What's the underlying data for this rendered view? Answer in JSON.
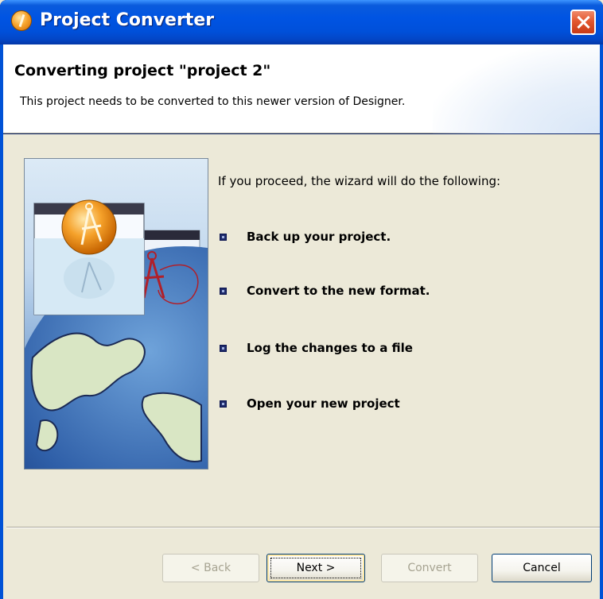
{
  "window": {
    "title": "Project Converter",
    "title_icon": "project-converter-app-icon",
    "close_icon": "close-icon"
  },
  "header": {
    "title": "Converting project \"project 2\"",
    "subtitle": "This project needs to be converted to this newer version of Designer."
  },
  "body": {
    "intro": "If you proceed, the wizard will do the following:",
    "steps": [
      "Back up your project.",
      "Convert to the new format.",
      "Log the changes to a file",
      "Open your new project"
    ]
  },
  "buttons": {
    "back": "< Back",
    "next": "Next >",
    "convert": "Convert",
    "cancel": "Cancel"
  },
  "colors": {
    "titlebar": "#0054E3",
    "dialog_bg": "#ECE9D8",
    "header_bg": "#FFFFFF",
    "bullet": "#1E2A6A"
  }
}
